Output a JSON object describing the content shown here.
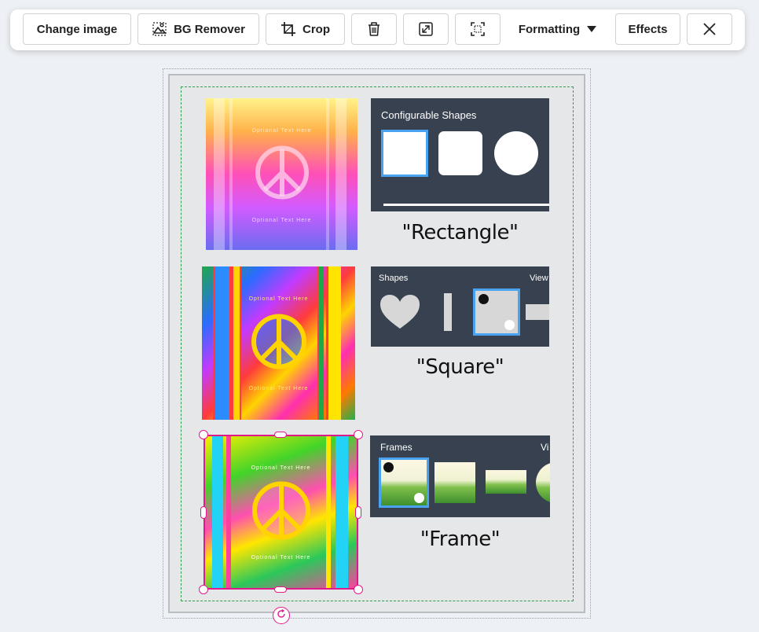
{
  "toolbar": {
    "change_image": "Change image",
    "bg_remover": "BG Remover",
    "crop": "Crop",
    "formatting": "Formatting",
    "effects": "Effects",
    "icons": {
      "bg_remover": "bg-remover-icon",
      "crop": "crop-icon",
      "delete": "trash-icon",
      "resize": "expand-icon",
      "fit": "fit-frame-icon",
      "formatting_dropdown": "caret-down-icon",
      "close": "close-icon"
    }
  },
  "artwork": {
    "text_top": "Optional Text Here",
    "text_bottom": "Optional Text Here"
  },
  "rows": [
    {
      "panel_title": "Configurable Shapes",
      "caption": "\"Rectangle\""
    },
    {
      "panel_title": "Shapes",
      "panel_link": "View",
      "caption": "\"Square\""
    },
    {
      "panel_title": "Frames",
      "panel_link": "Vi",
      "caption": "\"Frame\""
    }
  ],
  "colors": {
    "selection": "#e0198a",
    "panel_bg": "#37414f",
    "highlight": "#4aa3f0",
    "guide": "#2e9c4a"
  }
}
